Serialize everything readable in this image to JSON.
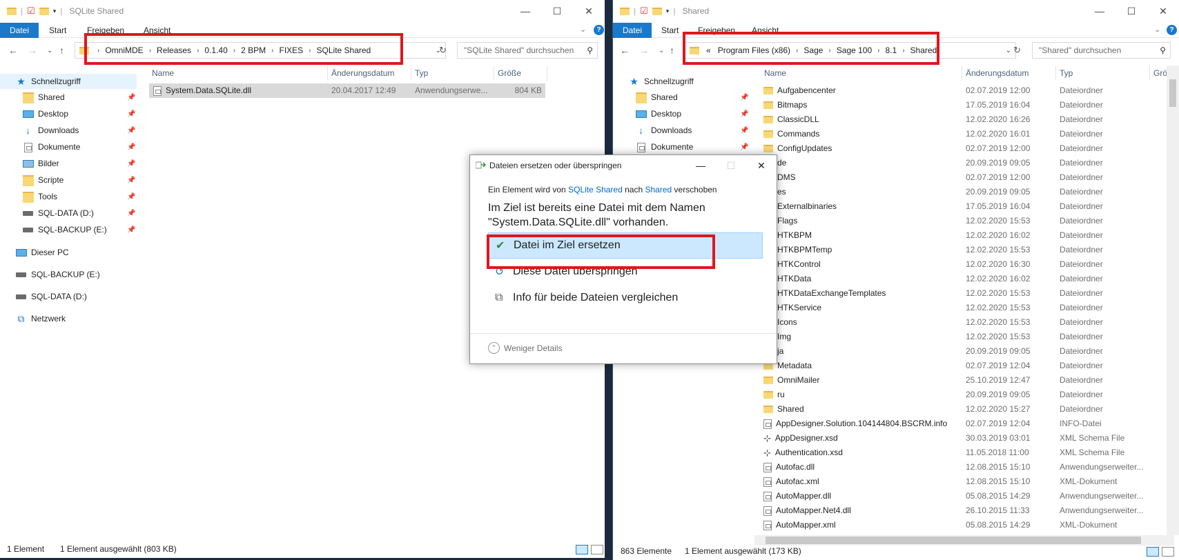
{
  "left_window": {
    "title": "SQLite Shared",
    "ribbon_tabs": [
      "Datei",
      "Start",
      "Freigeben",
      "Ansicht"
    ],
    "breadcrumb": [
      "OmniMDE",
      "Releases",
      "0.1.40",
      "2 BPM",
      "FIXES",
      "SQLite Shared"
    ],
    "search_placeholder": "\"SQLite Shared\" durchsuchen",
    "sidebar": {
      "quick_access": "Schnellzugriff",
      "pinned": [
        {
          "label": "Shared",
          "icon": "folder-icon"
        },
        {
          "label": "Desktop",
          "icon": "desktop-icon"
        },
        {
          "label": "Downloads",
          "icon": "download-icon"
        },
        {
          "label": "Dokumente",
          "icon": "document-icon"
        },
        {
          "label": "Bilder",
          "icon": "pictures-icon"
        },
        {
          "label": "Scripte",
          "icon": "folder-icon"
        },
        {
          "label": "Tools",
          "icon": "folder-icon"
        },
        {
          "label": "SQL-DATA (D:)",
          "icon": "drive-icon"
        },
        {
          "label": "SQL-BACKUP (E:)",
          "icon": "drive-icon"
        }
      ],
      "this_pc": "Dieser PC",
      "drives": [
        "SQL-BACKUP (E:)",
        "SQL-DATA (D:)"
      ],
      "network": "Netzwerk"
    },
    "columns": [
      "Name",
      "Änderungsdatum",
      "Typ",
      "Größe"
    ],
    "files": [
      {
        "name": "System.Data.SQLite.dll",
        "date": "20.04.2017 12:49",
        "type": "Anwendungserwe...",
        "size": "804 KB"
      }
    ],
    "status_count": "1 Element",
    "status_selected": "1 Element ausgewählt (803 KB)"
  },
  "right_window": {
    "title": "Shared",
    "ribbon_tabs": [
      "Datei",
      "Start",
      "Freigeben",
      "Ansicht"
    ],
    "breadcrumb_prefix": "«",
    "breadcrumb": [
      "Program Files (x86)",
      "Sage",
      "Sage 100",
      "8.1",
      "Shared"
    ],
    "search_placeholder": "\"Shared\" durchsuchen",
    "sidebar": {
      "quick_access": "Schnellzugriff",
      "pinned": [
        "Shared",
        "Desktop",
        "Downloads",
        "Dokumente"
      ]
    },
    "columns": [
      "Name",
      "Änderungsdatum",
      "Typ",
      "Größ"
    ],
    "files": [
      {
        "name": "Aufgabencenter",
        "date": "02.07.2019 12:00",
        "type": "Dateiordner",
        "icon": "folder"
      },
      {
        "name": "Bitmaps",
        "date": "17.05.2019 16:04",
        "type": "Dateiordner",
        "icon": "folder"
      },
      {
        "name": "ClassicDLL",
        "date": "12.02.2020 16:26",
        "type": "Dateiordner",
        "icon": "folder"
      },
      {
        "name": "Commands",
        "date": "12.02.2020 16:01",
        "type": "Dateiordner",
        "icon": "folder"
      },
      {
        "name": "ConfigUpdates",
        "date": "02.07.2019 12:00",
        "type": "Dateiordner",
        "icon": "folder"
      },
      {
        "name": "de",
        "date": "20.09.2019 09:05",
        "type": "Dateiordner",
        "icon": "folder"
      },
      {
        "name": "DMS",
        "date": "02.07.2019 12:00",
        "type": "Dateiordner",
        "icon": "folder"
      },
      {
        "name": "es",
        "date": "20.09.2019 09:05",
        "type": "Dateiordner",
        "icon": "folder"
      },
      {
        "name": "Externalbinaries",
        "date": "17.05.2019 16:04",
        "type": "Dateiordner",
        "icon": "folder"
      },
      {
        "name": "Flags",
        "date": "12.02.2020 15:53",
        "type": "Dateiordner",
        "icon": "folder"
      },
      {
        "name": "HTKBPM",
        "date": "12.02.2020 16:02",
        "type": "Dateiordner",
        "icon": "folder"
      },
      {
        "name": "HTKBPMTemp",
        "date": "12.02.2020 15:53",
        "type": "Dateiordner",
        "icon": "folder"
      },
      {
        "name": "HTKControl",
        "date": "12.02.2020 16:30",
        "type": "Dateiordner",
        "icon": "folder"
      },
      {
        "name": "HTKData",
        "date": "12.02.2020 16:02",
        "type": "Dateiordner",
        "icon": "folder"
      },
      {
        "name": "HTKDataExchangeTemplates",
        "date": "12.02.2020 15:53",
        "type": "Dateiordner",
        "icon": "folder"
      },
      {
        "name": "HTKService",
        "date": "12.02.2020 15:53",
        "type": "Dateiordner",
        "icon": "folder"
      },
      {
        "name": "Icons",
        "date": "12.02.2020 15:53",
        "type": "Dateiordner",
        "icon": "folder"
      },
      {
        "name": "Img",
        "date": "12.02.2020 15:53",
        "type": "Dateiordner",
        "icon": "folder"
      },
      {
        "name": "ja",
        "date": "20.09.2019 09:05",
        "type": "Dateiordner",
        "icon": "folder"
      },
      {
        "name": "Metadata",
        "date": "02.07.2019 12:04",
        "type": "Dateiordner",
        "icon": "folder"
      },
      {
        "name": "OmniMailer",
        "date": "25.10.2019 12:47",
        "type": "Dateiordner",
        "icon": "folder"
      },
      {
        "name": "ru",
        "date": "20.09.2019 09:05",
        "type": "Dateiordner",
        "icon": "folder"
      },
      {
        "name": "Shared",
        "date": "12.02.2020 15:27",
        "type": "Dateiordner",
        "icon": "folder"
      },
      {
        "name": "AppDesigner.Solution.104144804.BSCRM.info",
        "date": "02.07.2019 12:04",
        "type": "INFO-Datei",
        "icon": "file"
      },
      {
        "name": "AppDesigner.xsd",
        "date": "30.03.2019 03:01",
        "type": "XML Schema File",
        "icon": "schema"
      },
      {
        "name": "Authentication.xsd",
        "date": "11.05.2018 11:00",
        "type": "XML Schema File",
        "icon": "schema"
      },
      {
        "name": "Autofac.dll",
        "date": "12.08.2015 15:10",
        "type": "Anwendungserweiter...",
        "icon": "file"
      },
      {
        "name": "Autofac.xml",
        "date": "12.08.2015 15:10",
        "type": "XML-Dokument",
        "icon": "file"
      },
      {
        "name": "AutoMapper.dll",
        "date": "05.08.2015 14:29",
        "type": "Anwendungserweiter...",
        "icon": "file"
      },
      {
        "name": "AutoMapper.Net4.dll",
        "date": "26.10.2015 11:33",
        "type": "Anwendungserweiter...",
        "icon": "file"
      },
      {
        "name": "AutoMapper.xml",
        "date": "05.08.2015 14:29",
        "type": "XML-Dokument",
        "icon": "file"
      }
    ],
    "status_count": "863 Elemente",
    "status_selected": "1 Element ausgewählt (173 KB)"
  },
  "dialog": {
    "title": "Dateien ersetzen oder überspringen",
    "move_prefix": "Ein Element wird von",
    "source": "SQLite Shared",
    "move_mid": "nach",
    "target": "Shared",
    "move_suffix": "verschoben",
    "headline_1": "Im Ziel ist bereits eine Datei mit dem Namen",
    "headline_2": "\"System.Data.SQLite.dll\" vorhanden.",
    "option_replace": "Datei im Ziel ersetzen",
    "option_skip": "Diese Datei überspringen",
    "option_compare": "Info für beide Dateien vergleichen",
    "less_details": "Weniger Details"
  },
  "colors": {
    "accent": "#1979ca",
    "highlight_red": "#e0161d",
    "selection": "#cce8ff"
  }
}
